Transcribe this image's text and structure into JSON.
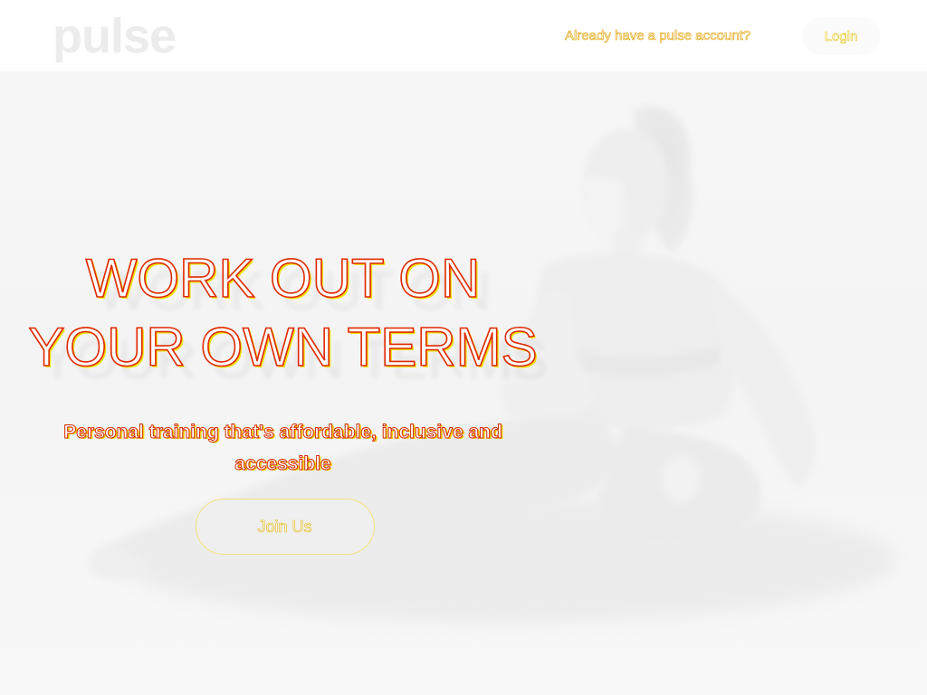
{
  "header": {
    "logo_text": "pulse",
    "account_prompt": "Already have a pulse account?",
    "login_label": "Login"
  },
  "hero": {
    "title_line1": "WORK OUT ON",
    "title_line2": "YOUR OWN TERMS",
    "subtitle_line1": "Personal training that's affordable, inclusive and",
    "subtitle_line2": "accessible",
    "cta_label": "Join Us"
  },
  "colors": {
    "header_background": "#ffffff",
    "page_background": "#f6f6f6",
    "logo": "#ececec",
    "text_outline_red": "#e02800",
    "text_outline_yellow": "#f0e200"
  },
  "icons": {
    "hero_image": "woman-stretching-photo"
  }
}
